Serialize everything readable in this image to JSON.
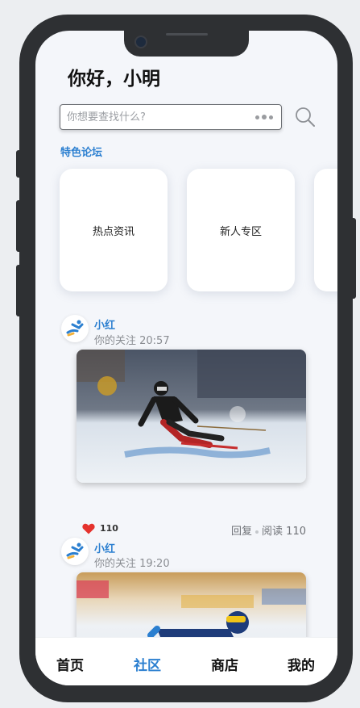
{
  "header": {
    "greeting": "你好，小明"
  },
  "search": {
    "placeholder": "你想要查找什么?",
    "value": ""
  },
  "forum": {
    "section_title": "特色论坛",
    "cards": [
      {
        "label": "热点资讯"
      },
      {
        "label": "新人专区"
      },
      {
        "label": ""
      }
    ]
  },
  "posts": [
    {
      "author": "小红",
      "meta": "你的关注 20:57",
      "likes": "110",
      "reply_label": "回复",
      "read_label": "阅读 110"
    },
    {
      "author": "小红",
      "meta": "你的关注 19:20"
    }
  ],
  "tabbar": {
    "tabs": [
      {
        "label": "首页"
      },
      {
        "label": "社区"
      },
      {
        "label": "商店"
      },
      {
        "label": "我的"
      }
    ],
    "active": "社区"
  },
  "colors": {
    "accent": "#2b7fd0",
    "like": "#e5322d",
    "phone_frame": "#2e3033"
  }
}
